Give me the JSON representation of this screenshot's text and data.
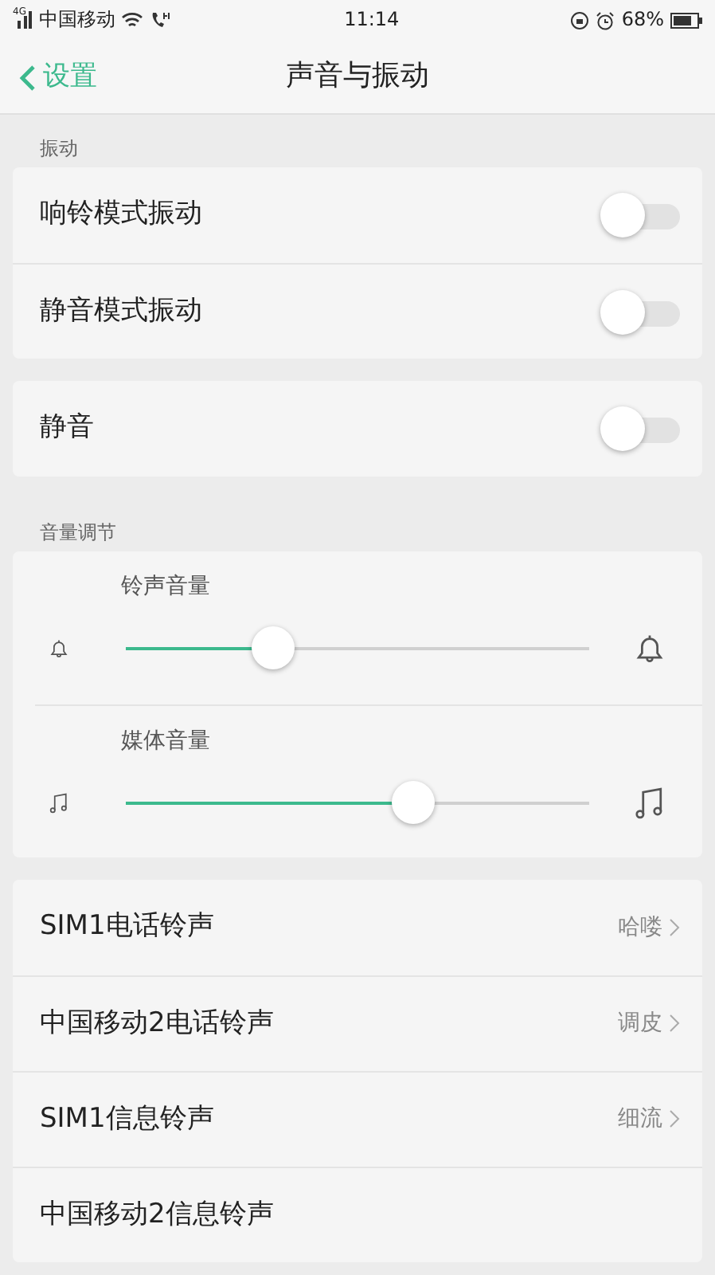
{
  "status_bar": {
    "carrier": "中国移动",
    "network": "4G",
    "time": "11:14",
    "battery": "68%"
  },
  "header": {
    "back": "设置",
    "title": "声音与振动"
  },
  "sections": [
    {
      "label": "振动",
      "groups": [
        [
          {
            "kind": "toggle",
            "label": "响铃模式振动",
            "on": false
          },
          {
            "kind": "toggle",
            "label": "静音模式振动",
            "on": false
          }
        ],
        [
          {
            "kind": "toggle",
            "label": "静音",
            "on": false
          }
        ]
      ]
    },
    {
      "label": "音量调节",
      "groups": [
        [
          {
            "kind": "slider",
            "label": "铃声音量",
            "level": 0.315
          },
          {
            "kind": "slider",
            "label": "媒体音量",
            "level": 0.62
          }
        ],
        [
          {
            "kind": "link",
            "label": "SIM1电话铃声",
            "value": "哈喽"
          },
          {
            "kind": "link",
            "label": "中国移动2电话铃声",
            "value": "调皮"
          },
          {
            "kind": "link",
            "label": "SIM1信息铃声",
            "value": "细流"
          },
          {
            "kind": "link",
            "label": "中国移动2信息铃声"
          }
        ]
      ]
    }
  ]
}
